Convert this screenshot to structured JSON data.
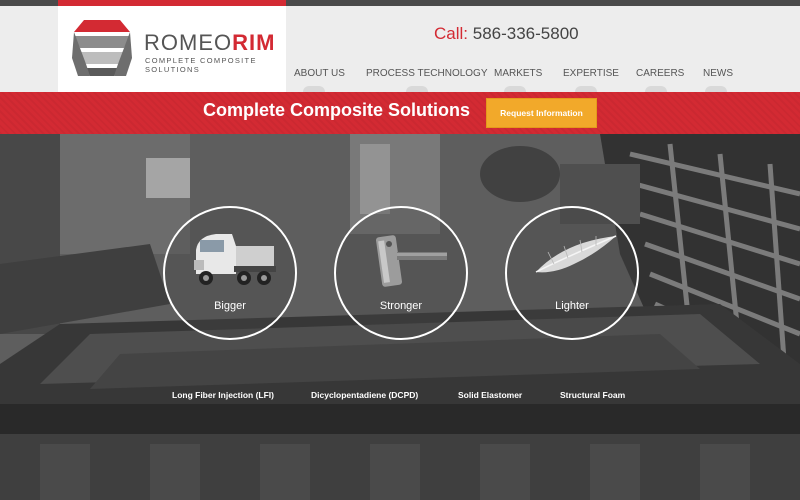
{
  "brand": {
    "name_part1": "ROMEO",
    "name_part2": "RIM",
    "tagline": "COMPLETE COMPOSITE SOLUTIONS"
  },
  "contact": {
    "label": "Call:",
    "phone": "586-336-5800"
  },
  "nav": {
    "items": [
      {
        "label": "ABOUT US"
      },
      {
        "label": "PROCESS TECHNOLOGY"
      },
      {
        "label": "MARKETS"
      },
      {
        "label": "EXPERTISE"
      },
      {
        "label": "CAREERS"
      },
      {
        "label": "NEWS"
      }
    ]
  },
  "band": {
    "title": "Complete Composite Solutions",
    "button_label": "Request Information"
  },
  "features": [
    {
      "label": "Bigger",
      "icon": "truck-icon"
    },
    {
      "label": "Stronger",
      "icon": "hammer-icon"
    },
    {
      "label": "Lighter",
      "icon": "feather-icon"
    }
  ],
  "technologies": [
    "Long Fiber Injection (LFI)",
    "Dicyclopentadiene (DCPD)",
    "Solid Elastomer",
    "Structural Foam"
  ],
  "colors": {
    "brand_red": "#d32a33",
    "button_orange": "#f2a92a",
    "header_gray": "#ededed",
    "top_bar": "#4a4a4a"
  }
}
